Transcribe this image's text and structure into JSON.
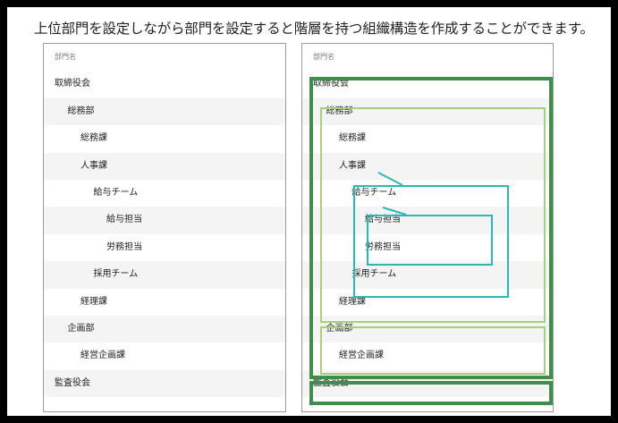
{
  "caption": "上位部門を設定しながら部門を設定すると階層を持つ組織構造を作成することができます。",
  "header": "部門名",
  "departments": [
    {
      "name": "取締役会",
      "level": 0
    },
    {
      "name": "総務部",
      "level": 1
    },
    {
      "name": "総務課",
      "level": 2
    },
    {
      "name": "人事課",
      "level": 2
    },
    {
      "name": "給与チーム",
      "level": 3
    },
    {
      "name": "給与担当",
      "level": 4
    },
    {
      "name": "労務担当",
      "level": 4
    },
    {
      "name": "採用チーム",
      "level": 3
    },
    {
      "name": "経理課",
      "level": 2
    },
    {
      "name": "企画部",
      "level": 1
    },
    {
      "name": "経営企画課",
      "level": 2
    },
    {
      "name": "監査役会",
      "level": 0
    }
  ],
  "colors": {
    "dark_green": "#3f8f4a",
    "light_green": "#a4d27a",
    "teal": "#29b9b9"
  }
}
